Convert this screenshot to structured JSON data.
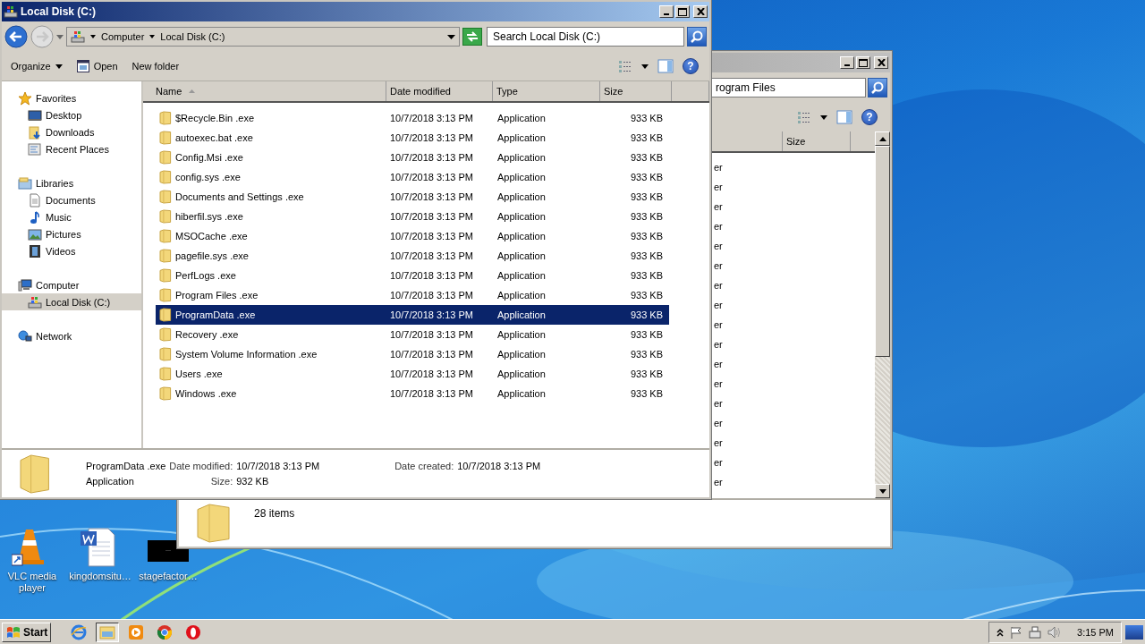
{
  "desktop_icons": [
    {
      "label": "VLC media player",
      "kind": "cone"
    },
    {
      "label": "kingdomsitu…",
      "kind": "document"
    },
    {
      "label": "stagefactor…",
      "kind": "black"
    }
  ],
  "back_window": {
    "search": {
      "value": "rogram Files"
    },
    "help": "?",
    "columns": [
      {
        "label": "Size"
      }
    ],
    "rows": [
      {
        "type": "er"
      },
      {
        "type": "er"
      },
      {
        "type": "er"
      },
      {
        "type": "er"
      },
      {
        "type": "er"
      },
      {
        "type": "er"
      },
      {
        "type": "er"
      },
      {
        "type": "er"
      },
      {
        "type": "er"
      },
      {
        "type": "er"
      },
      {
        "type": "er"
      },
      {
        "type": "er"
      },
      {
        "type": "er"
      },
      {
        "type": "er"
      },
      {
        "type": "er"
      },
      {
        "type": "er"
      },
      {
        "type": "er"
      }
    ],
    "status_bar": {
      "count": "28 items"
    }
  },
  "front_window": {
    "title": "Local Disk (C:)",
    "breadcrumb": [
      "Computer",
      "Local Disk (C:)"
    ],
    "search": {
      "placeholder": "Search Local Disk (C:)"
    },
    "help": "?",
    "toolbar": [
      {
        "label": "Organize",
        "kind": "menu"
      },
      {
        "label": "Open",
        "kind": "open"
      },
      {
        "label": "New folder",
        "kind": "plain"
      }
    ],
    "nav": [
      {
        "label": "Favorites",
        "kind": "star",
        "selected": false,
        "children": [
          {
            "label": "Desktop",
            "kind": "desktop",
            "selected": false
          },
          {
            "label": "Downloads",
            "kind": "downloads",
            "selected": false
          },
          {
            "label": "Recent Places",
            "kind": "recent",
            "selected": false
          }
        ]
      },
      {
        "label": "Libraries",
        "kind": "libraries",
        "selected": false,
        "children": [
          {
            "label": "Documents",
            "kind": "documents",
            "selected": false
          },
          {
            "label": "Music",
            "kind": "music",
            "selected": false
          },
          {
            "label": "Pictures",
            "kind": "pictures",
            "selected": false
          },
          {
            "label": "Videos",
            "kind": "videos",
            "selected": false
          }
        ]
      },
      {
        "label": "Computer",
        "kind": "computer",
        "selected": false,
        "children": [
          {
            "label": "Local Disk (C:)",
            "kind": "drive",
            "selected": true
          }
        ]
      },
      {
        "label": "Network",
        "kind": "network",
        "selected": false
      }
    ],
    "columns": [
      {
        "label": "Name",
        "sorted": true
      },
      {
        "label": "Date modified",
        "sorted": false
      },
      {
        "label": "Type",
        "sorted": false
      },
      {
        "label": "Size",
        "sorted": false
      }
    ],
    "rows": [
      {
        "name": "$Recycle.Bin .exe",
        "date": "10/7/2018 3:13 PM",
        "type": "Application",
        "size": "933 KB",
        "selected": false
      },
      {
        "name": "autoexec.bat .exe",
        "date": "10/7/2018 3:13 PM",
        "type": "Application",
        "size": "933 KB",
        "selected": false
      },
      {
        "name": "Config.Msi .exe",
        "date": "10/7/2018 3:13 PM",
        "type": "Application",
        "size": "933 KB",
        "selected": false
      },
      {
        "name": "config.sys .exe",
        "date": "10/7/2018 3:13 PM",
        "type": "Application",
        "size": "933 KB",
        "selected": false
      },
      {
        "name": "Documents and Settings .exe",
        "date": "10/7/2018 3:13 PM",
        "type": "Application",
        "size": "933 KB",
        "selected": false
      },
      {
        "name": "hiberfil.sys .exe",
        "date": "10/7/2018 3:13 PM",
        "type": "Application",
        "size": "933 KB",
        "selected": false
      },
      {
        "name": "MSOCache .exe",
        "date": "10/7/2018 3:13 PM",
        "type": "Application",
        "size": "933 KB",
        "selected": false
      },
      {
        "name": "pagefile.sys .exe",
        "date": "10/7/2018 3:13 PM",
        "type": "Application",
        "size": "933 KB",
        "selected": false
      },
      {
        "name": "PerfLogs .exe",
        "date": "10/7/2018 3:13 PM",
        "type": "Application",
        "size": "933 KB",
        "selected": false
      },
      {
        "name": "Program Files .exe",
        "date": "10/7/2018 3:13 PM",
        "type": "Application",
        "size": "933 KB",
        "selected": false
      },
      {
        "name": "ProgramData .exe",
        "date": "10/7/2018 3:13 PM",
        "type": "Application",
        "size": "933 KB",
        "selected": true
      },
      {
        "name": "Recovery .exe",
        "date": "10/7/2018 3:13 PM",
        "type": "Application",
        "size": "933 KB",
        "selected": false
      },
      {
        "name": "System Volume Information .exe",
        "date": "10/7/2018 3:13 PM",
        "type": "Application",
        "size": "933 KB",
        "selected": false
      },
      {
        "name": "Users .exe",
        "date": "10/7/2018 3:13 PM",
        "type": "Application",
        "size": "933 KB",
        "selected": false
      },
      {
        "name": "Windows .exe",
        "date": "10/7/2018 3:13 PM",
        "type": "Application",
        "size": "933 KB",
        "selected": false
      }
    ],
    "details": {
      "name": "ProgramData .exe",
      "type": "Application",
      "fields": [
        {
          "label": "Date modified:",
          "value": "10/7/2018 3:13 PM"
        },
        {
          "label": "Date created:",
          "value": "10/7/2018 3:13 PM"
        },
        {
          "label": "Size:",
          "value": "932 KB"
        }
      ]
    }
  },
  "taskbar": {
    "start": "Start",
    "apps": [
      {
        "kind": "ie",
        "active": false
      },
      {
        "kind": "explorer",
        "active": true
      },
      {
        "kind": "media",
        "active": false
      },
      {
        "kind": "chrome",
        "active": false
      },
      {
        "kind": "opera",
        "active": false
      }
    ],
    "clock": "3:15 PM"
  }
}
